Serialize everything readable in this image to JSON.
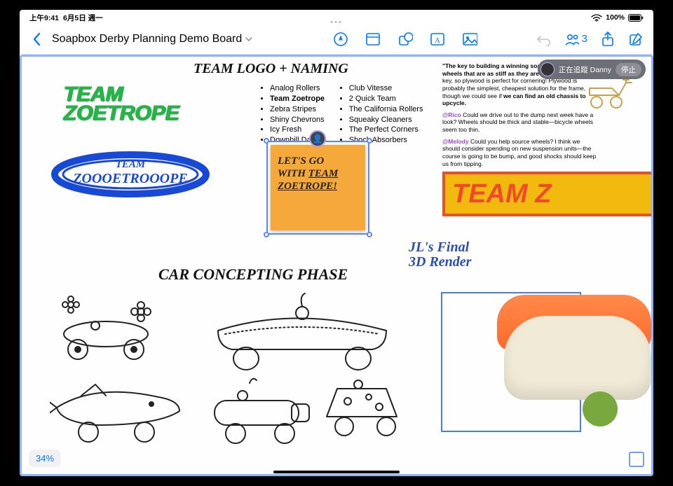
{
  "status": {
    "time": "上午9:41",
    "date": "6月5日 週一",
    "battery": "100%"
  },
  "toolbar": {
    "board_title": "Soapbox Derby Planning Demo Board",
    "collab_count": "3"
  },
  "headings": {
    "logo_naming": "TEAM LOGO + NAMING",
    "concepting": "CAR CONCEPTING PHASE",
    "render": "JL's Final\n3D Render"
  },
  "logos": {
    "green_line1": "TEAM",
    "green_line2": "ZOETROPE",
    "blue_top": "TEAM",
    "blue_bottom": "ZOOOETROOOPE",
    "orange": "TEAM Z"
  },
  "names_col1": [
    "Analog Rollers",
    "Team Zoetrope",
    "Zebra Stripes",
    "Shiny Chevrons",
    "Icy Fresh",
    "Downhill Daisies"
  ],
  "names_col2": [
    "Club Vitesse",
    "2 Quick Team",
    "The California Rollers",
    "Squeaky Cleaners",
    "The Perfect Corners",
    "Shock Absorbers"
  ],
  "sticky": {
    "line1": "LET'S GO",
    "line2": "WITH ",
    "underline": "TEAM",
    "line3": "ZOETROPE!"
  },
  "commentary": {
    "p1a": "\"The key to building a winning soapbox derby car is wheels that are as stiff as they are light.\"",
    "p1b": " Stiffness is key, so plywood is perfect for cornering! Plywood is probably the simplest, cheapest solution for the frame, though we could see if ",
    "p1c": "we can find an old chassis to upcycle.",
    "m1": "@Rico",
    "p2": " Could we drive out to the dump next week have a look? Wheels should be thick and stable—bicycle wheels seem too thin.",
    "m2": "@Melody",
    "p3": " Could you help source wheels? I think we should consider spending on new suspension units—the course is going to be bump, and good shocks should keep us from tipping."
  },
  "tracking": {
    "label": "正在追蹤 Danny",
    "stop": "停止"
  },
  "zoom": "34%"
}
